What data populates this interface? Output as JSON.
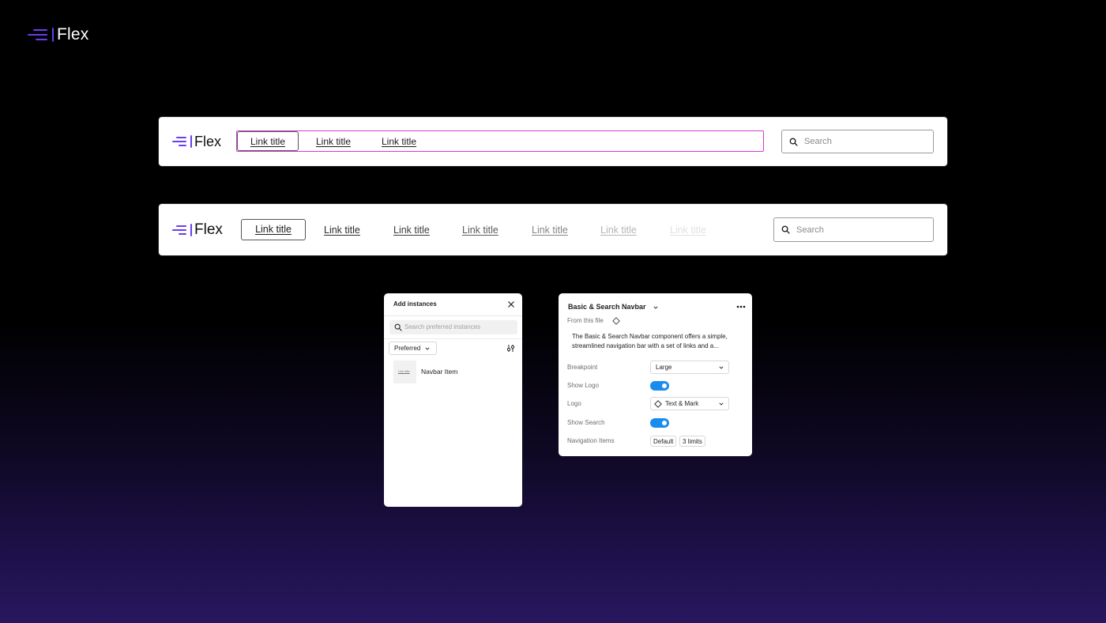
{
  "brand": {
    "name": "Flex"
  },
  "colors": {
    "brand_purple": "#6a3df0",
    "selection_magenta": "#d43bd4",
    "toggle_blue": "#1a8cf0"
  },
  "navbar_top": {
    "links": [
      "Link title",
      "Link title",
      "Link title"
    ],
    "search_placeholder": "Search"
  },
  "navbar_wide": {
    "links": [
      "Link title",
      "Link title",
      "Link title",
      "Link title",
      "Link title",
      "Link title",
      "Link title"
    ],
    "search_placeholder": "Search"
  },
  "add_instances": {
    "title": "Add instances",
    "search_placeholder": "Search preferred instances",
    "filter_label": "Preferred",
    "item_thumb": "Link title",
    "item_label": "Navbar Item"
  },
  "props_panel": {
    "title": "Basic & Search Navbar",
    "source": "From this file",
    "description_line1": "The Basic & Search Navbar component offers a simple,",
    "description_line2": "streamlined navigation bar with a set of links and a...",
    "rows": {
      "breakpoint_label": "Breakpoint",
      "breakpoint_value": "Large",
      "show_logo_label": "Show Logo",
      "logo_label": "Logo",
      "logo_value": "Text & Mark",
      "show_search_label": "Show Search",
      "nav_items_label": "Navigation Items",
      "nav_items_value1": "Default",
      "nav_items_value2": "3 limits"
    }
  }
}
